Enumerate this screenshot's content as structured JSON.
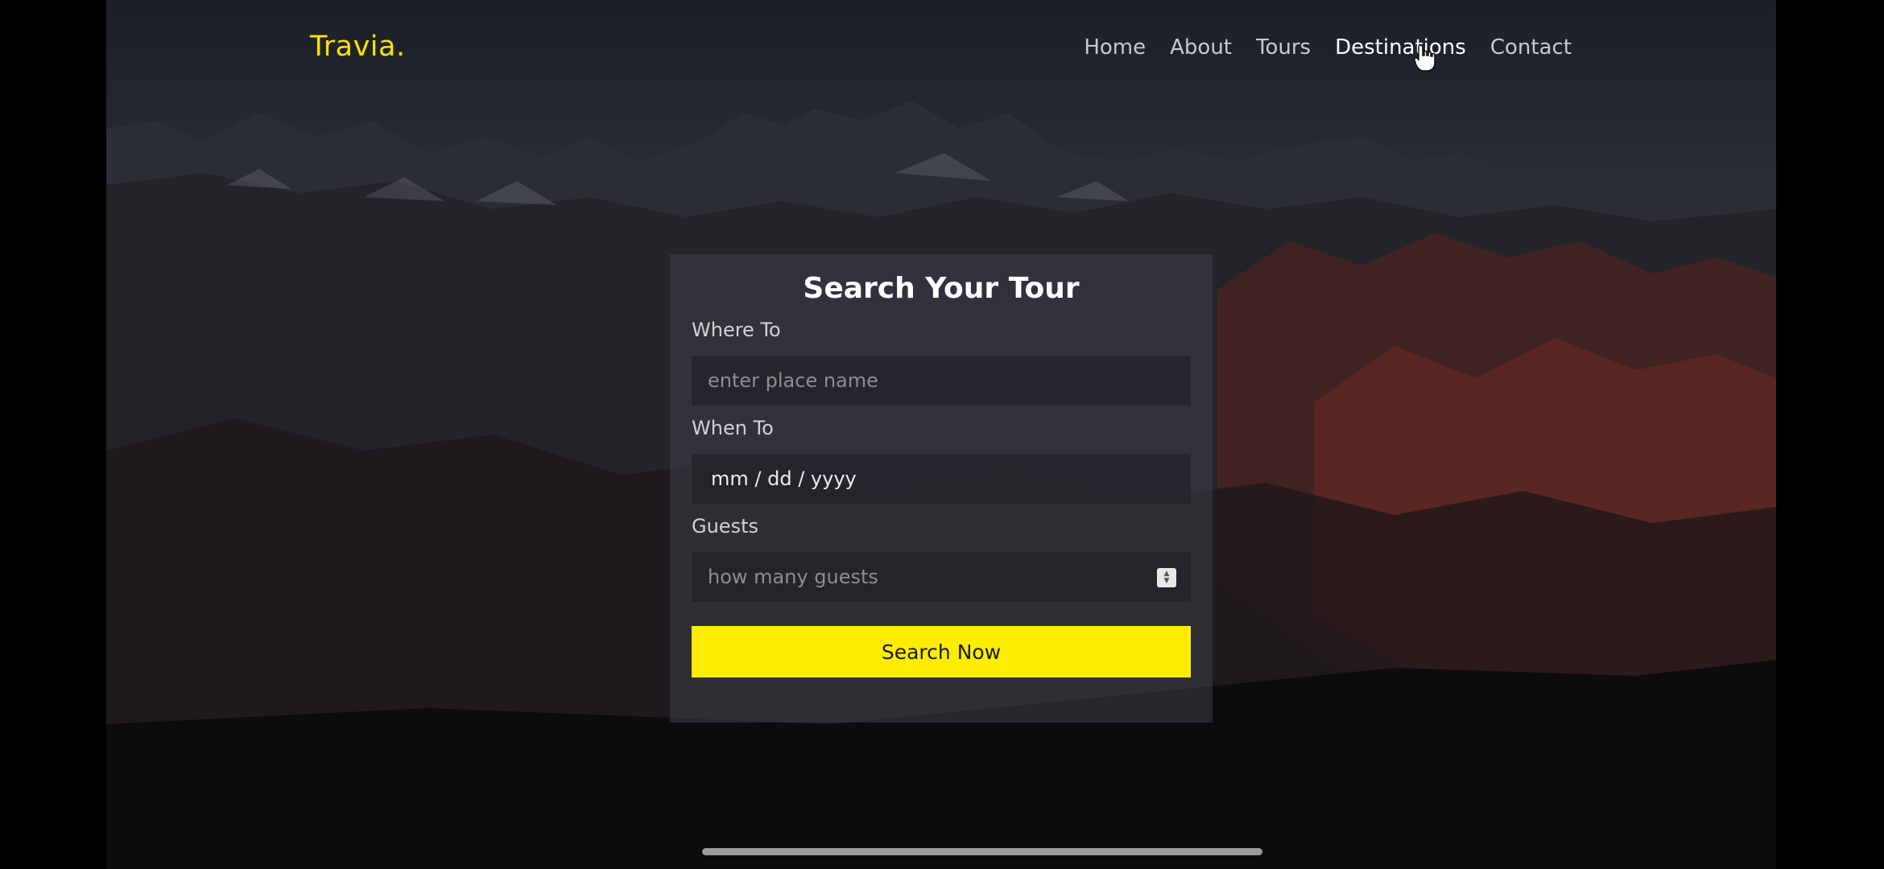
{
  "brand": {
    "logo": "Travia."
  },
  "nav": {
    "items": [
      {
        "label": "Home",
        "active": false
      },
      {
        "label": "About",
        "active": false
      },
      {
        "label": "Tours",
        "active": false
      },
      {
        "label": "Destinations",
        "active": true
      },
      {
        "label": "Contact",
        "active": false
      }
    ]
  },
  "search": {
    "title": "Search Your Tour",
    "where": {
      "label": "Where To",
      "placeholder": "enter place name"
    },
    "when": {
      "label": "When To",
      "value": "mm / dd / yyyy"
    },
    "guests": {
      "label": "Guests",
      "placeholder": "how many guests"
    },
    "button": "Search Now"
  },
  "colors": {
    "accent": "#ffed00",
    "logo": "#ffe100",
    "nav_text": "#c9c9c9",
    "nav_active": "#ffffff"
  },
  "icons": {
    "cursor": "hand-pointer-icon",
    "stepper": "number-stepper-icon"
  }
}
